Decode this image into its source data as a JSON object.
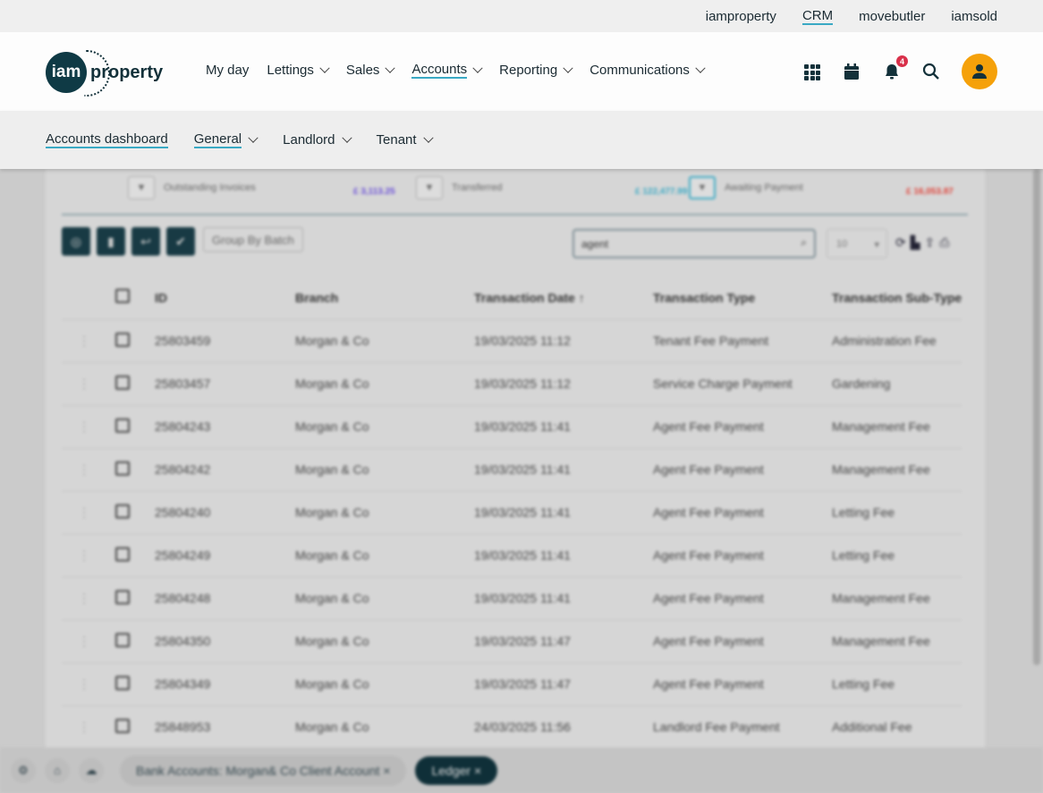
{
  "util_nav": [
    {
      "label": "iamproperty",
      "active": false
    },
    {
      "label": "CRM",
      "active": true
    },
    {
      "label": "movebutler",
      "active": false
    },
    {
      "label": "iamsold",
      "active": false
    }
  ],
  "logo": {
    "mark": "iam",
    "word": "property"
  },
  "nav": [
    {
      "label": "My day",
      "dropdown": false
    },
    {
      "label": "Lettings",
      "dropdown": true
    },
    {
      "label": "Sales",
      "dropdown": true
    },
    {
      "label": "Accounts",
      "dropdown": true,
      "active": true
    },
    {
      "label": "Reporting",
      "dropdown": true
    },
    {
      "label": "Communications",
      "dropdown": true
    }
  ],
  "header_icons": {
    "apps": "grid-icon",
    "calendar": "calendar-icon",
    "notifications": "bell-icon",
    "notification_count": "4",
    "search": "search-icon",
    "user": "user-icon"
  },
  "colors": {
    "accent": "#3aa9c4",
    "brand": "#0f3a45",
    "avatar": "#f5a10a",
    "badge": "#d9304a"
  },
  "subnav": [
    {
      "label": "Accounts dashboard",
      "dropdown": false,
      "active": true
    },
    {
      "label": "General",
      "dropdown": true,
      "active": true
    },
    {
      "label": "Landlord",
      "dropdown": true
    },
    {
      "label": "Tenant",
      "dropdown": true
    }
  ],
  "stats": [
    {
      "label": "Outstanding Invoices",
      "amount": "£ 3,113.25",
      "color": "#6a4fd8"
    },
    {
      "label": "Transferred",
      "amount": "£ 122,477.99",
      "color": "#3aa9c4"
    },
    {
      "label": "Awaiting Payment",
      "amount": "£ 16,053.87",
      "color": "#e0443a"
    }
  ],
  "toolbar": {
    "group_by_batch": "Group By Batch",
    "search_value": "agent",
    "page_size": "10"
  },
  "table": {
    "columns": [
      "ID",
      "Branch",
      "Transaction Date",
      "Transaction Type",
      "Transaction Sub-Type"
    ],
    "rows": [
      [
        "25803459",
        "Morgan & Co",
        "19/03/2025 11:12",
        "Tenant Fee Payment",
        "Administration Fee"
      ],
      [
        "25803457",
        "Morgan & Co",
        "19/03/2025 11:12",
        "Service Charge Payment",
        "Gardening"
      ],
      [
        "25804243",
        "Morgan & Co",
        "19/03/2025 11:41",
        "Agent Fee Payment",
        "Management Fee"
      ],
      [
        "25804242",
        "Morgan & Co",
        "19/03/2025 11:41",
        "Agent Fee Payment",
        "Management Fee"
      ],
      [
        "25804240",
        "Morgan & Co",
        "19/03/2025 11:41",
        "Agent Fee Payment",
        "Letting Fee"
      ],
      [
        "25804249",
        "Morgan & Co",
        "19/03/2025 11:41",
        "Agent Fee Payment",
        "Letting Fee"
      ],
      [
        "25804248",
        "Morgan & Co",
        "19/03/2025 11:41",
        "Agent Fee Payment",
        "Management Fee"
      ],
      [
        "25804350",
        "Morgan & Co",
        "19/03/2025 11:47",
        "Agent Fee Payment",
        "Management Fee"
      ],
      [
        "25804349",
        "Morgan & Co",
        "19/03/2025 11:47",
        "Agent Fee Payment",
        "Letting Fee"
      ],
      [
        "25848953",
        "Morgan & Co",
        "24/03/2025 11:56",
        "Landlord Fee Payment",
        "Additional Fee"
      ]
    ]
  },
  "bottom_tabs": [
    {
      "label": "Bank Accounts: Morgan& Co Client Account",
      "close": "×"
    },
    {
      "label": "Ledger",
      "close": "×",
      "active": true
    }
  ]
}
